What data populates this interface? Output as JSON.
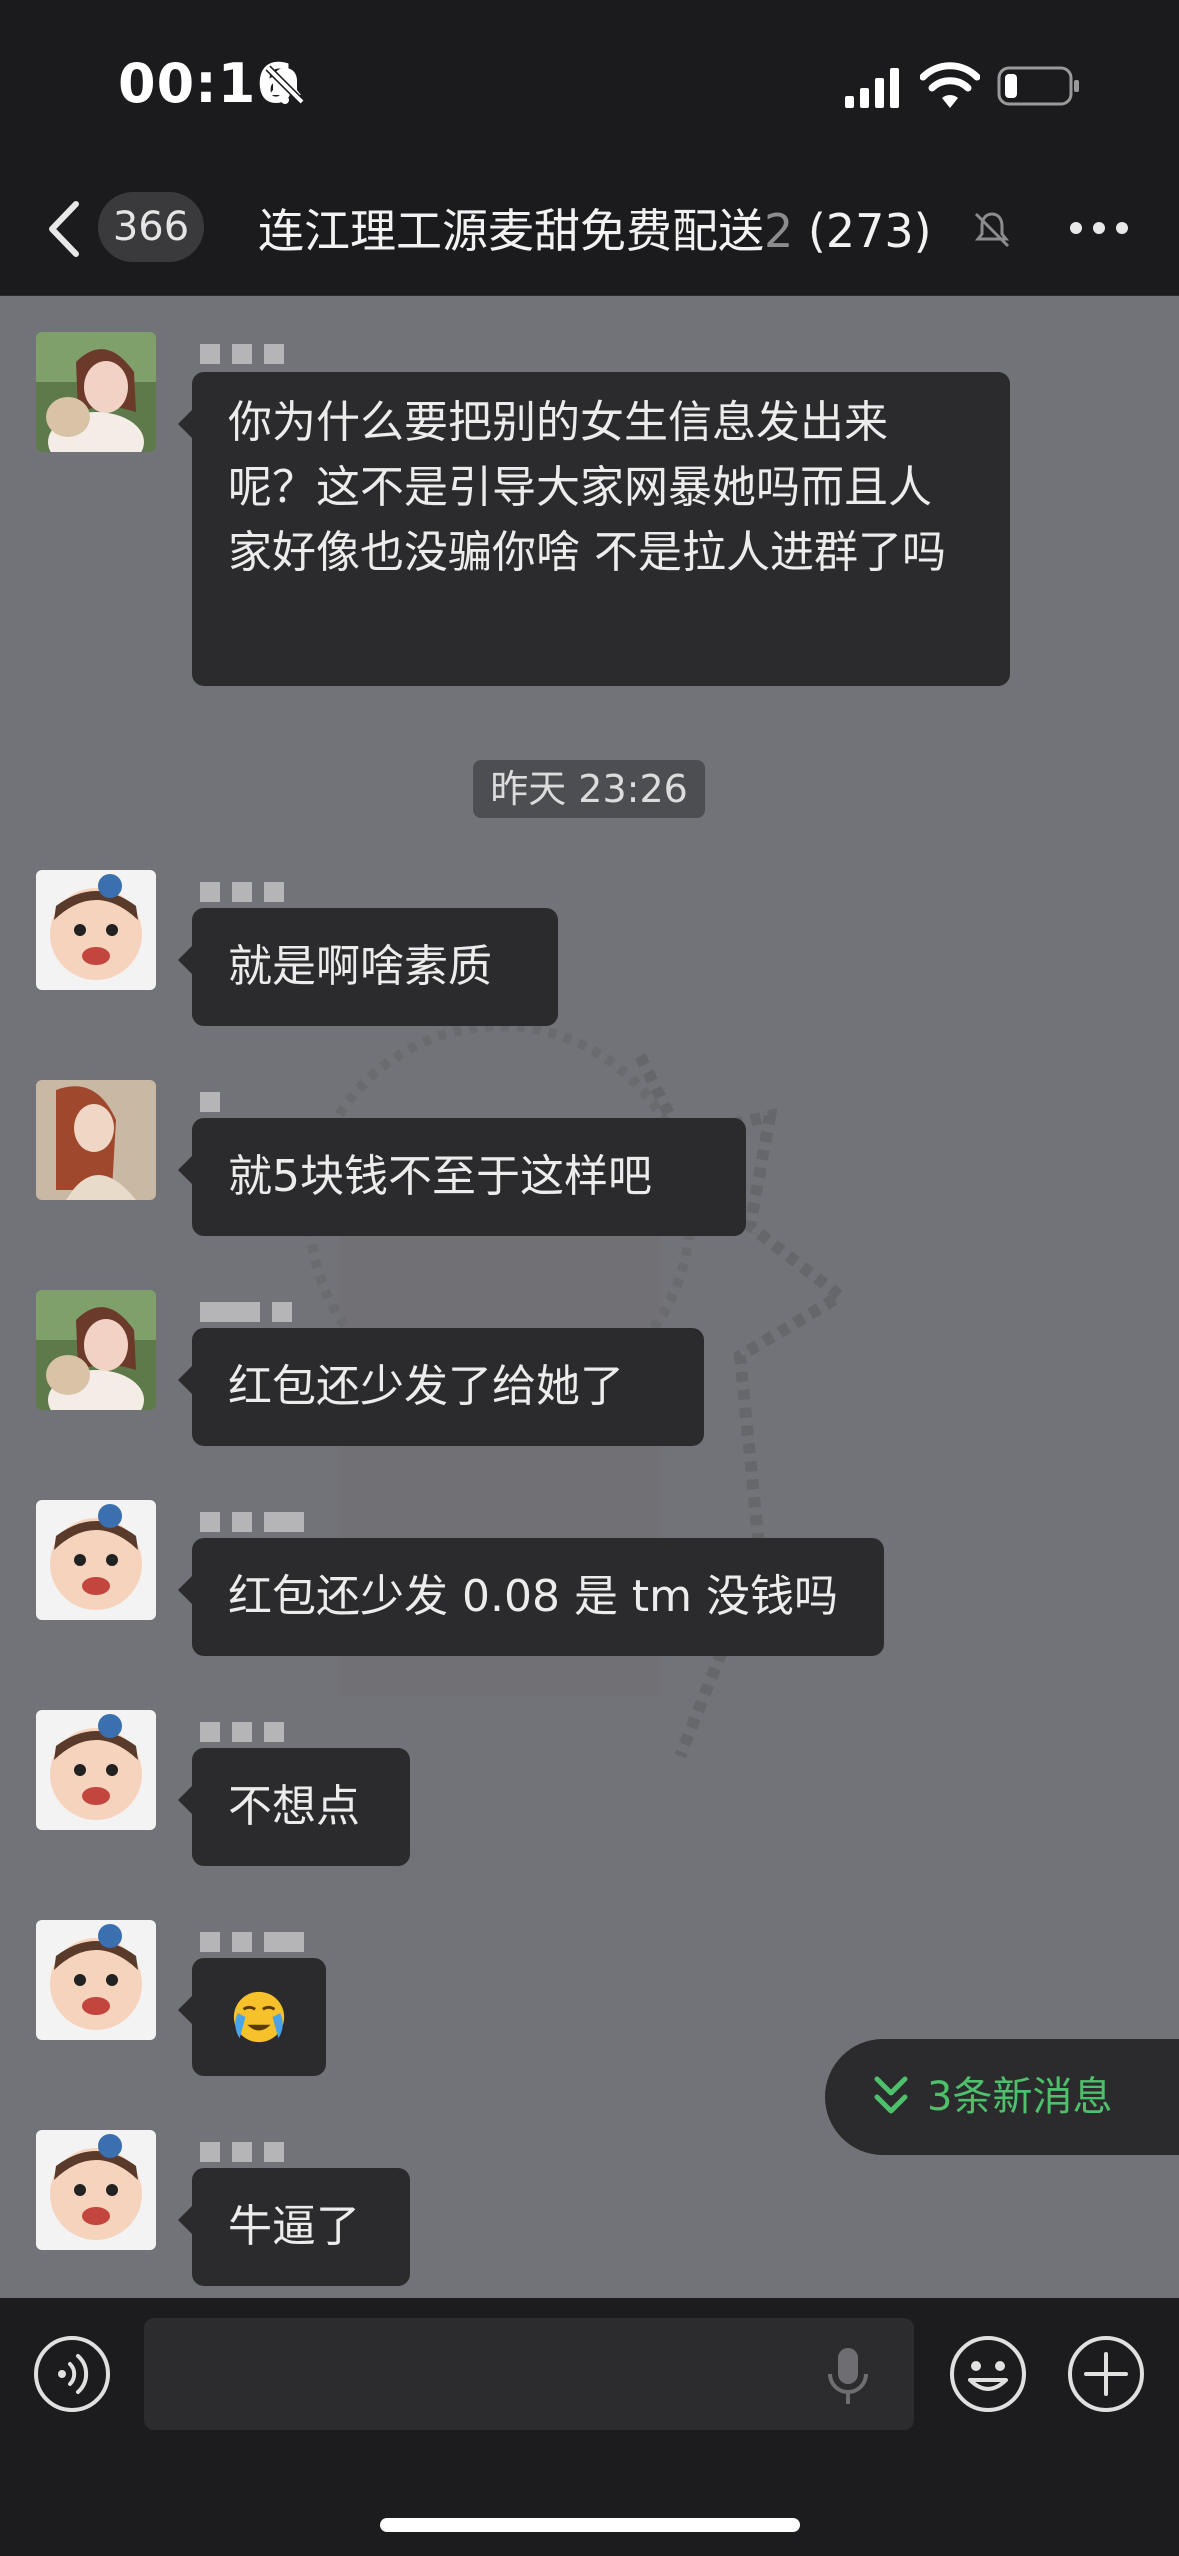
{
  "status_bar": {
    "time": "00:16"
  },
  "header": {
    "unread_count": "366",
    "title": "连江理工源麦甜免费配送",
    "title_suffix": "2",
    "member_count": "(273)"
  },
  "timestamp": "昨天 23:26",
  "messages": [
    {
      "text": "你为什么要把别的女生信息发出来呢？这不是引导大家网暴她吗而且人家好像也没骗你啥 不是拉人进群了吗"
    },
    {
      "text": "就是啊啥素质"
    },
    {
      "text": "就5块钱不至于这样吧"
    },
    {
      "text": "红包还少发了给她了"
    },
    {
      "text": "红包还少发 0.08 是 tm 没钱吗"
    },
    {
      "text": "不想点"
    },
    {
      "text": "😭",
      "emoji": "crying-face"
    },
    {
      "text": "牛逼了"
    }
  ],
  "new_messages_label": "3条新消息",
  "colors": {
    "chat_bg": "#727378",
    "bubble": "#2b2b2d",
    "accent_green": "#4ec06c",
    "bar_bg": "#1b1b1d"
  }
}
